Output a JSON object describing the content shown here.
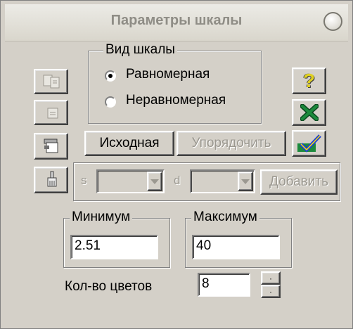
{
  "window": {
    "title": "Параметры шкалы"
  },
  "scale_type": {
    "legend": "Вид шкалы",
    "options": [
      {
        "label": "Равномерная",
        "selected": true
      },
      {
        "label": "Неравномерная",
        "selected": false
      }
    ]
  },
  "buttons": {
    "source_label": "Исходная",
    "order_label": "Упорядочить",
    "add_label": "Добавить",
    "help_glyph": "?"
  },
  "step_row": {
    "s_label": "s",
    "d_label": "d"
  },
  "minimum": {
    "legend": "Минимум",
    "value": "2.51"
  },
  "maximum": {
    "legend": "Максимум",
    "value": "40"
  },
  "colors": {
    "label": "Кол-во цветов",
    "value": "8"
  },
  "icons": {
    "left_1": "copy-pages-icon",
    "left_2": "paste-page-icon",
    "left_3": "layer-icon",
    "left_4": "brush-icon",
    "help": "help-icon",
    "cancel": "close-icon",
    "apply": "apply-check-icon"
  },
  "palette": {
    "help_yellow": "#e0d020",
    "cancel_green": "#1c8a3c",
    "apply_blue": "#1a3fd8"
  }
}
